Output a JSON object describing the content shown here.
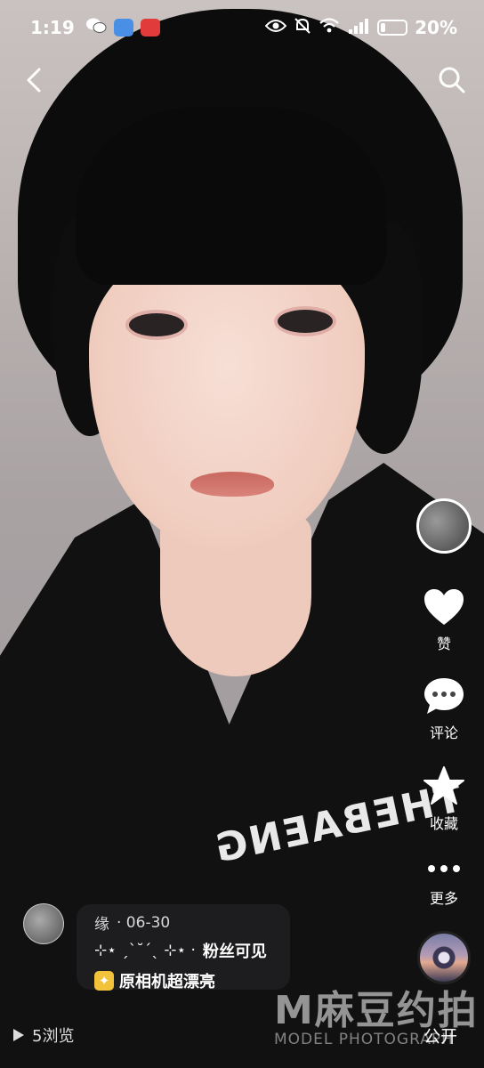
{
  "status_bar": {
    "time": "1:19",
    "battery_text": "20%",
    "battery_level": 0.2,
    "icons": [
      "wechat-icon",
      "message-icon",
      "app-red-icon",
      "eye-icon",
      "mute-icon",
      "wifi-icon",
      "signal-5g-icon",
      "battery-icon"
    ]
  },
  "nav": {
    "back_icon": "chevron-left-icon",
    "search_icon": "search-icon"
  },
  "rail": {
    "like_label": "赞",
    "comment_label": "评论",
    "favorite_label": "收藏",
    "more_label": "更多"
  },
  "post": {
    "author": "缘",
    "date": "· 06-30",
    "caption_decoration": "⊹⋆ ˏˋ˘ˊˎ ⊹⋆ ·",
    "visibility": "粉丝可见",
    "tag": "原相机超漂亮"
  },
  "bottom": {
    "views": "5浏览",
    "public_label": "公开"
  },
  "watermark": {
    "main": "M麻豆约拍",
    "sub": "MODEL PHOTOGRAPH"
  },
  "shirt_print": "THEBAENG",
  "colors": {
    "accent_sparkle": "#f2c23a",
    "white": "#ffffff"
  }
}
